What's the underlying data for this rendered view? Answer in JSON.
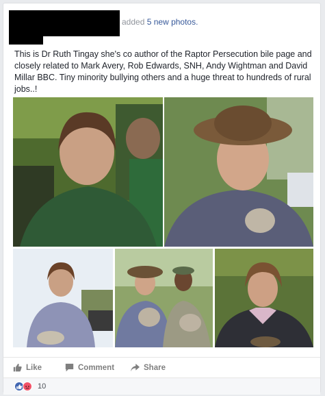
{
  "post": {
    "action_text": "added",
    "action_link": "5 new photos.",
    "body": "This is Dr Ruth Tingay she's co author of the Raptor Persecution bile page and closely related to Mark Avery, Rob Edwards, SNH, Andy Wightman and David Millar BBC. Tiny minority bullying others and a huge threat to hundreds of rural jobs..!"
  },
  "actions": {
    "like_label": "Like",
    "comment_label": "Comment",
    "share_label": "Share"
  },
  "reactions": {
    "icons": [
      "like-icon",
      "angry-icon"
    ],
    "count": "10"
  },
  "colors": {
    "link": "#365899",
    "like_blue": "#4267b2",
    "angry_orange": "#f25268"
  }
}
